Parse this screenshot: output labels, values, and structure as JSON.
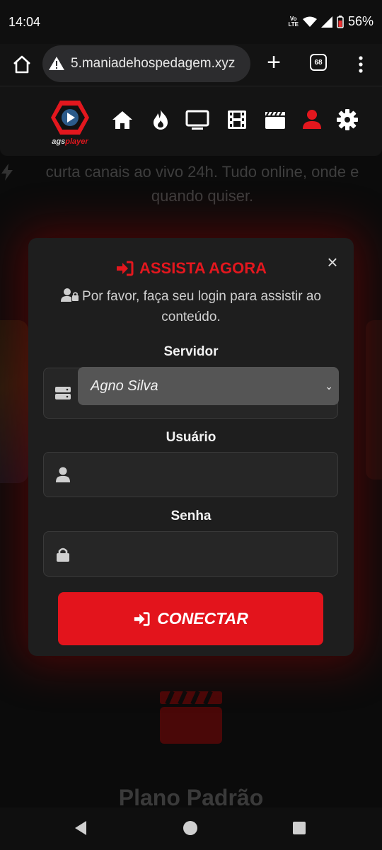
{
  "status_bar": {
    "time": "14:04",
    "volte": "Vo\nLTE",
    "battery": "56%",
    "icons": [
      "volte-icon",
      "wifi-icon",
      "signal-icon",
      "battery-icon"
    ]
  },
  "browser": {
    "url": "5.maniadehospedagem.xyz",
    "tab_count": "68",
    "new_tab_label": "+"
  },
  "site_header": {
    "logo_text_left": "ags",
    "logo_text_right": "player",
    "nav_icons": [
      "home-icon",
      "fire-icon",
      "tv-icon",
      "film-icon",
      "clapperboard-icon",
      "user-icon",
      "gear-icon"
    ],
    "accent_color": "#e3171e"
  },
  "background": {
    "hero_text": "curta canais ao vivo 24h. Tudo online, onde e quando quiser.",
    "plan_title": "Plano Padrão"
  },
  "modal": {
    "title": "ASSISTA AGORA",
    "close_label": "×",
    "subtitle": "Por favor, faça seu login para assistir ao conteúdo.",
    "server_label": "Servidor",
    "server_value": "Agno Silva",
    "username_label": "Usuário",
    "username_placeholder": "",
    "password_label": "Senha",
    "password_placeholder": "",
    "connect_label": "CONECTAR"
  }
}
